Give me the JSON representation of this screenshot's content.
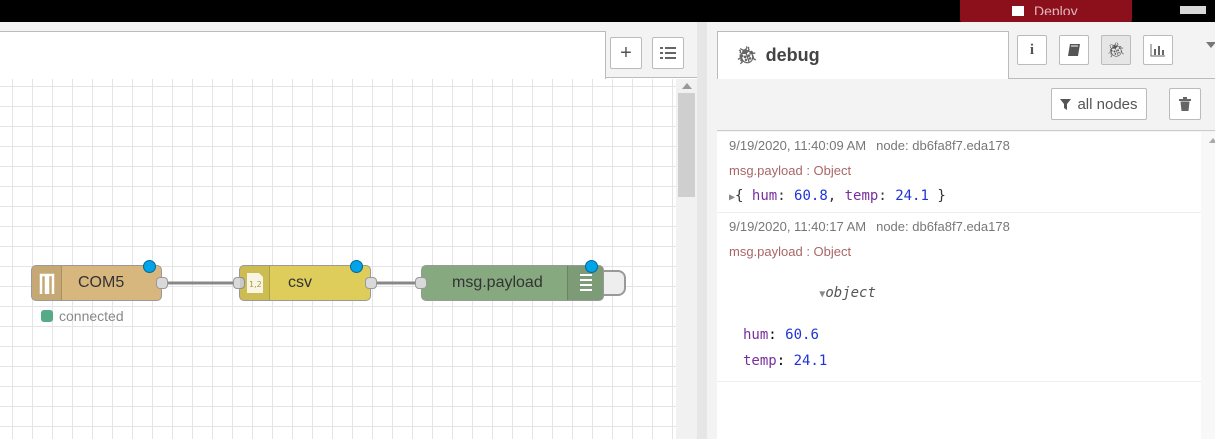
{
  "header": {
    "deploy_label": "Deploy",
    "deploy_color": "#8c101c"
  },
  "workspace": {
    "toolbar": {
      "add_icon": "plus-icon",
      "list_icon": "list-icon"
    },
    "nodes": [
      {
        "label": "COM5",
        "icon": "serial-port-icon",
        "color": "#d7b77e",
        "status": "connected",
        "status_color": "#5a8"
      },
      {
        "label": "csv",
        "icon": "csv-icon",
        "color": "#decd5a"
      },
      {
        "label": "msg.payload",
        "icon": "debug-icon",
        "color": "#87a980"
      }
    ]
  },
  "sidebar": {
    "tab_label": "debug",
    "tab_icon": "bug-icon",
    "icons": [
      "info-icon",
      "book-icon",
      "bug-icon",
      "chart-icon"
    ],
    "filter_label": "all nodes",
    "messages": [
      {
        "timestamp": "9/19/2020, 11:40:09 AM",
        "node": "node: db6fa8f7.eda178",
        "topic": "msg.payload : Object",
        "summary_open": "{ ",
        "hum_key": "hum",
        "hum_val": "60.8",
        "temp_key": "temp",
        "temp_val": "24.1",
        "summary_close": " }"
      },
      {
        "timestamp": "9/19/2020, 11:40:17 AM",
        "node": "node: db6fa8f7.eda178",
        "topic": "msg.payload : Object",
        "object_label": "object",
        "props": [
          {
            "key": "hum",
            "value": "60.6"
          },
          {
            "key": "temp",
            "value": "24.1"
          }
        ]
      }
    ]
  }
}
